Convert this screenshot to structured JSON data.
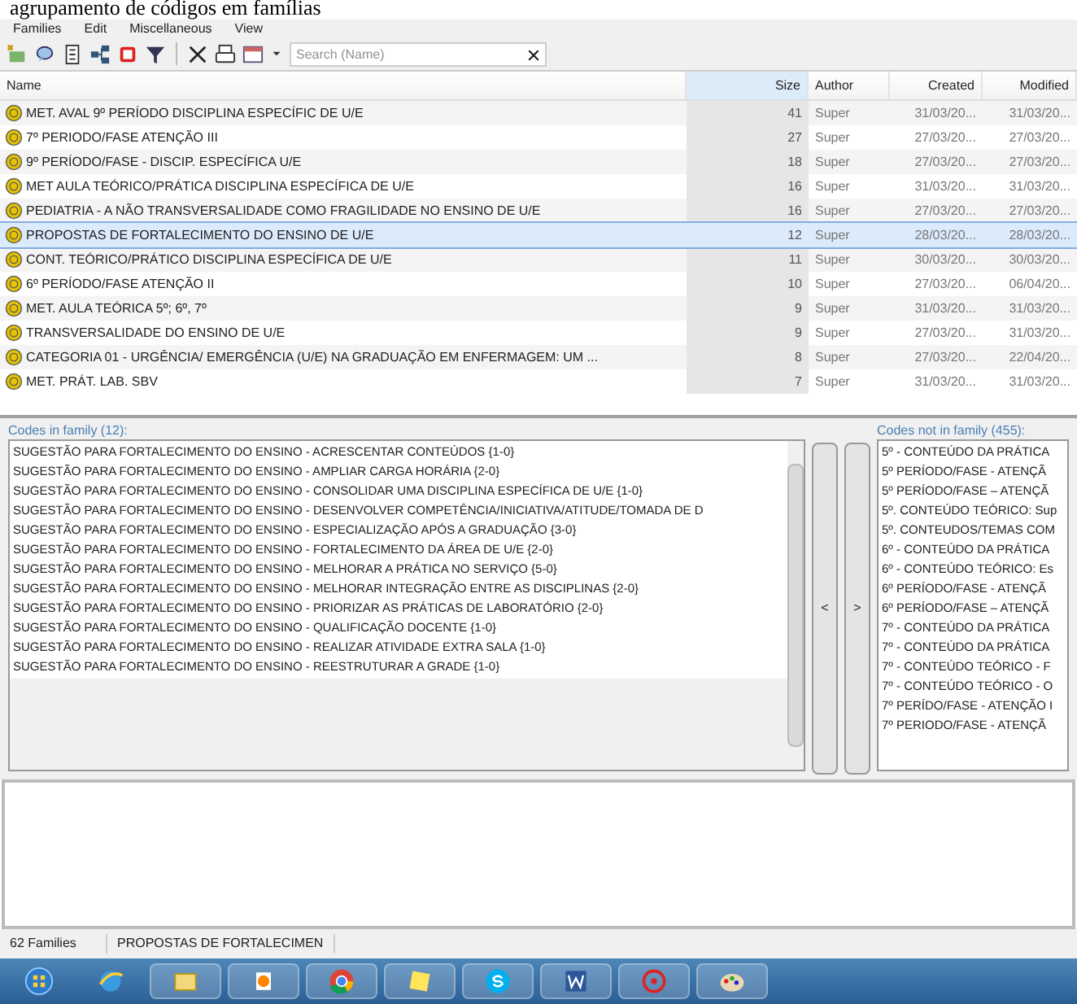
{
  "caption": "agrupamento de códigos em famílias",
  "menu": [
    "Families",
    "Edit",
    "Miscellaneous",
    "View"
  ],
  "search": {
    "placeholder": "Search (Name)"
  },
  "table": {
    "columns": [
      "Name",
      "Size",
      "Author",
      "Created",
      "Modified"
    ],
    "rows": [
      {
        "name": "MET. AVAL 9º PERÍODO DISCIPLINA ESPECÍFIC DE U/E",
        "size": "41",
        "author": "Super",
        "created": "31/03/20...",
        "modified": "31/03/20...",
        "selected": false
      },
      {
        "name": "7º PERIODO/FASE ATENÇÃO III",
        "size": "27",
        "author": "Super",
        "created": "27/03/20...",
        "modified": "27/03/20...",
        "selected": false
      },
      {
        "name": "9º PERÍODO/FASE - DISCIP. ESPECÍFICA U/E",
        "size": "18",
        "author": "Super",
        "created": "27/03/20...",
        "modified": "27/03/20...",
        "selected": false
      },
      {
        "name": "MET AULA TEÓRICO/PRÁTICA DISCIPLINA ESPECÍFICA DE U/E",
        "size": "16",
        "author": "Super",
        "created": "31/03/20...",
        "modified": "31/03/20...",
        "selected": false
      },
      {
        "name": "PEDIATRIA - A NÃO TRANSVERSALIDADE COMO FRAGILIDADE NO ENSINO DE U/E",
        "size": "16",
        "author": "Super",
        "created": "27/03/20...",
        "modified": "27/03/20...",
        "selected": false
      },
      {
        "name": "PROPOSTAS DE FORTALECIMENTO DO ENSINO DE U/E",
        "size": "12",
        "author": "Super",
        "created": "28/03/20...",
        "modified": "28/03/20...",
        "selected": true
      },
      {
        "name": "CONT. TEÓRICO/PRÁTICO DISCIPLINA ESPECÍFICA DE U/E",
        "size": "11",
        "author": "Super",
        "created": "30/03/20...",
        "modified": "30/03/20...",
        "selected": false
      },
      {
        "name": "6º PERÍODO/FASE ATENÇÃO II",
        "size": "10",
        "author": "Super",
        "created": "27/03/20...",
        "modified": "06/04/20...",
        "selected": false
      },
      {
        "name": "MET. AULA TEÓRICA 5º; 6º, 7º",
        "size": "9",
        "author": "Super",
        "created": "31/03/20...",
        "modified": "31/03/20...",
        "selected": false
      },
      {
        "name": "TRANSVERSALIDADE DO ENSINO DE U/E",
        "size": "9",
        "author": "Super",
        "created": "27/03/20...",
        "modified": "31/03/20...",
        "selected": false
      },
      {
        "name": "CATEGORIA 01 - URGÊNCIA/ EMERGÊNCIA (U/E) NA GRADUAÇÃO EM ENFERMAGEM: UM ...",
        "size": "8",
        "author": "Super",
        "created": "27/03/20...",
        "modified": "22/04/20...",
        "selected": false
      },
      {
        "name": "MET. PRÁT. LAB. SBV",
        "size": "7",
        "author": "Super",
        "created": "31/03/20...",
        "modified": "31/03/20...",
        "selected": false
      }
    ]
  },
  "codes_in_family": {
    "title": "Codes in family (12):",
    "items": [
      "SUGESTÃO PARA FORTALECIMENTO DO ENSINO - ACRESCENTAR CONTEÚDOS {1-0}",
      "SUGESTÃO PARA FORTALECIMENTO DO ENSINO - AMPLIAR CARGA HORÁRIA {2-0}",
      "SUGESTÃO PARA FORTALECIMENTO DO ENSINO - CONSOLIDAR UMA DISCIPLINA ESPECÍFICA DE U/E {1-0}",
      "SUGESTÃO PARA FORTALECIMENTO DO ENSINO - DESENVOLVER  COMPETÊNCIA/INICIATIVA/ATITUDE/TOMADA DE D",
      "SUGESTÃO PARA FORTALECIMENTO DO ENSINO - ESPECIALIZAÇÃO APÓS A GRADUAÇÃO {3-0}",
      "SUGESTÃO PARA FORTALECIMENTO DO ENSINO - FORTALECIMENTO DA ÁREA DE U/E {2-0}",
      "SUGESTÃO PARA FORTALECIMENTO DO ENSINO - MELHORAR A PRÁTICA NO SERVIÇO {5-0}",
      "SUGESTÃO PARA FORTALECIMENTO DO ENSINO - MELHORAR INTEGRAÇÃO ENTRE AS DISCIPLINAS {2-0}",
      "SUGESTÃO PARA FORTALECIMENTO DO ENSINO - PRIORIZAR AS PRÁTICAS DE LABORATÓRIO {2-0}",
      "SUGESTÃO PARA FORTALECIMENTO DO ENSINO - QUALIFICAÇÃO DOCENTE {1-0}",
      "SUGESTÃO PARA FORTALECIMENTO DO ENSINO - REALIZAR ATIVIDADE EXTRA SALA {1-0}",
      "SUGESTÃO PARA FORTALECIMENTO DO ENSINO - REESTRUTURAR A GRADE {1-0}"
    ]
  },
  "move_buttons": [
    "<",
    ">"
  ],
  "codes_not_in_family": {
    "title": "Codes not in family (455):",
    "items": [
      "5º - CONTEÚDO DA PRÁTICA",
      "5º PERÍODO/FASE - ATENÇÃ",
      "5º PERÍODO/FASE – ATENÇÃ",
      "5º. CONTEÚDO TEÓRICO: Sup",
      "5º. CONTEUDOS/TEMAS COM",
      "6º - CONTEÚDO DA PRÁTICA",
      "6º - CONTEÚDO TEÓRICO: Es",
      "6º PERÍODO/FASE - ATENÇÃ",
      "6º PERÍODO/FASE – ATENÇÃ",
      "7º - CONTEÚDO DA PRÁTICA",
      "7º - CONTEÚDO DA PRÁTICA",
      "7º - CONTEÚDO TEÓRICO -  F",
      "7º - CONTEÚDO TEÓRICO - O",
      "7º PERÍDO/FASE - ATENÇÃO I",
      "7º PERIODO/FASE - ATENÇÃ"
    ]
  },
  "status_bar": [
    "62  Families",
    "PROPOSTAS DE FORTALECIMEN"
  ]
}
